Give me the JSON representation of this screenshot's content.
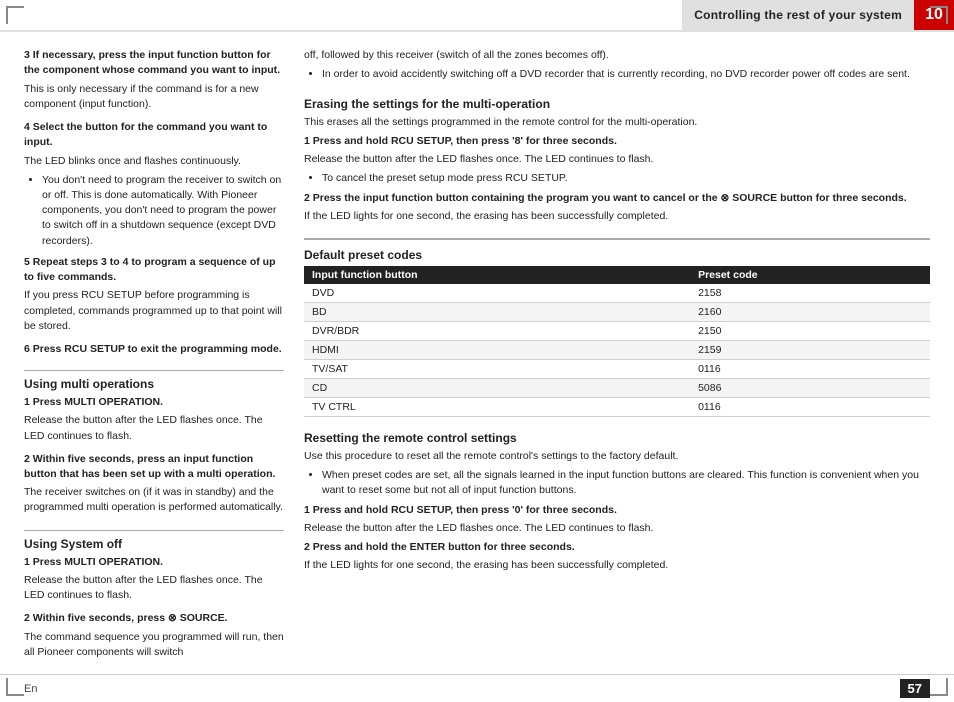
{
  "header": {
    "title": "Controlling the rest of your system",
    "chapter": "10"
  },
  "left_col": {
    "step3_heading": "3   If necessary, press the input function button for the component whose command you want to input.",
    "step3_note": "This is only necessary if the command is for a new component (input function).",
    "step4_heading": "4   Select the button for the command you want to input.",
    "step4_body": "The LED blinks once and flashes continuously.",
    "step4_bullet": "You don't need to program the receiver to switch on or off. This is done automatically. With Pioneer components, you don't need to program the power to switch off in a shutdown sequence (except DVD recorders).",
    "step5_heading": "5   Repeat steps 3 to 4 to program a sequence of up to five commands.",
    "step5_body": "If you press RCU SETUP before programming is completed, commands programmed up to that point will be stored.",
    "step6_heading": "6   Press RCU SETUP to exit the programming mode.",
    "using_multi_title": "Using multi operations",
    "multi_step1_heading": "1   Press MULTI OPERATION.",
    "multi_step1_body": "Release the button after the LED flashes once. The LED continues to flash.",
    "multi_step2_heading": "2   Within five seconds, press an input function button that has been set up with a multi operation.",
    "multi_step2_body": "The receiver switches on (if it was in standby) and the programmed multi operation is performed automatically.",
    "using_sysoff_title": "Using System off",
    "sysoff_step1_heading": "1   Press MULTI OPERATION.",
    "sysoff_step1_body": "Release the button after the LED flashes once. The LED continues to flash.",
    "sysoff_step2_heading": "2   Within five seconds, press ⊗ SOURCE.",
    "sysoff_step2_body": "The command sequence you programmed will run, then all Pioneer components will switch"
  },
  "right_col_top": {
    "sysoff_continued": "off, followed by this receiver (switch of all the zones becomes off).",
    "sysoff_bullet": "In order to avoid accidently switching off a DVD recorder that is currently recording, no DVD recorder power off codes are sent.",
    "erase_title": "Erasing the settings for the multi-operation",
    "erase_intro": "This erases all the settings programmed in the remote control for the multi-operation.",
    "erase_step1_heading": "1   Press and hold RCU SETUP, then press '8' for three seconds.",
    "erase_step1_body": "Release the button after the LED flashes once. The LED continues to flash.",
    "erase_step1_bullet": "To cancel the preset setup mode press RCU SETUP.",
    "erase_step2_heading": "2   Press the input function button containing the program you want to cancel or the ⊗ SOURCE button for three seconds.",
    "erase_step2_body": "If the LED lights for one second, the erasing has been successfully completed."
  },
  "right_col_bottom": {
    "reset_title": "Resetting the remote control settings",
    "reset_intro": "Use this procedure to reset all the remote control's settings to the factory default.",
    "reset_bullet1": "When preset codes are set, all the signals learned in the input function buttons are cleared. This function is convenient when you want to reset some but not all of input function buttons.",
    "reset_step1_heading": "1   Press and hold RCU SETUP, then press '0' for three seconds.",
    "reset_step1_body": "Release the button after the LED flashes once. The LED continues to flash.",
    "reset_step2_heading": "2   Press and hold the ENTER button for three seconds.",
    "reset_step2_body": "If the LED lights for one second, the erasing has been successfully completed."
  },
  "preset_table": {
    "title": "Default preset codes",
    "col1": "Input function button",
    "col2": "Preset code",
    "rows": [
      {
        "input": "DVD",
        "code": "2158"
      },
      {
        "input": "BD",
        "code": "2160"
      },
      {
        "input": "DVR/BDR",
        "code": "2150"
      },
      {
        "input": "HDMI",
        "code": "2159"
      },
      {
        "input": "TV/SAT",
        "code": "0116"
      },
      {
        "input": "CD",
        "code": "5086"
      },
      {
        "input": "TV CTRL",
        "code": "0116"
      }
    ]
  },
  "footer": {
    "lang": "En",
    "page": "57"
  }
}
